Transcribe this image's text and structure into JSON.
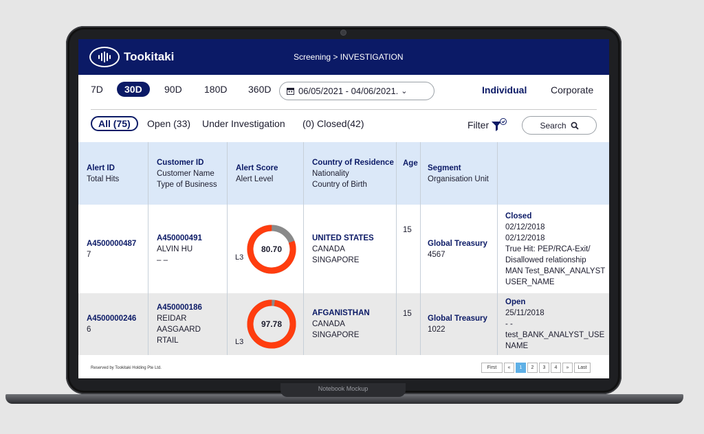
{
  "header": {
    "brand": "Tookitaki",
    "breadcrumb": "Screening > INVESTIGATION"
  },
  "periods": [
    "7D",
    "30D",
    "90D",
    "180D",
    "360D"
  ],
  "selected_period": "30D",
  "date_range": "06/05/2021 - 04/06/2021.",
  "segments": {
    "individual": "Individual",
    "corporate": "Corporate",
    "selected": "Individual"
  },
  "status_filters": {
    "all": "All (75)",
    "open": "Open (33)",
    "under_investigation": "Under Investigation",
    "closed": "(0) Closed(42)"
  },
  "filter_label": "Filter",
  "search_label": "Search",
  "table": {
    "headers": {
      "c1": {
        "main": "Alert ID",
        "sub": "Total Hits"
      },
      "c2": {
        "main": "Customer ID",
        "sub1": "Customer Name",
        "sub2": "Type of Business"
      },
      "c3": {
        "main": "Alert Score",
        "sub": "Alert Level"
      },
      "c4": {
        "main": "Country of Residence",
        "sub1": "Nationality",
        "sub2": "Country of Birth"
      },
      "c5": {
        "main": "Age"
      },
      "c6": {
        "main": "Segment",
        "sub": "Organisation Unit"
      }
    },
    "rows": [
      {
        "alert_id": "A4500000487",
        "total_hits": "7",
        "customer_id": "A450000491",
        "customer_name": "ALVIN HU",
        "business": "– –",
        "score": "80.70",
        "score_value": 80.7,
        "level": "L3",
        "residence": "UNITED STATES",
        "nationality": "CANADA",
        "birth": "SINGAPORE",
        "age": "15",
        "segment": "Global Treasury",
        "org_unit": "4567",
        "status": "Closed",
        "details": [
          "02/12/2018",
          "02/12/2018",
          "True Hit: PEP/RCA-Exit/",
          "Disallowed relationship",
          "MAN Test_BANK_ANALYST",
          "USER_NAME"
        ]
      },
      {
        "alert_id": "A4500000246",
        "total_hits": "6",
        "customer_id": "A450000186",
        "customer_name": "REIDAR AASGAARD",
        "business": "RTAIL",
        "score": "97.78",
        "score_value": 97.78,
        "level": "L3",
        "residence": "AFGANISTHAN",
        "nationality": "CANADA",
        "birth": "SINGAPORE",
        "age": "15",
        "segment": "Global Treasury",
        "org_unit": "1022",
        "status": "Open",
        "details": [
          "25/11/2018",
          "- -",
          "test_BANK_ANALYST_USE",
          "NAME"
        ]
      }
    ]
  },
  "footer": {
    "reserved": "Reserved by Tookitaki Holding Pte Ltd."
  },
  "pagination": {
    "first": "First",
    "prev": "«",
    "pages": [
      "1",
      "2",
      "3",
      "4"
    ],
    "next": "»",
    "last": "Last",
    "current": "1"
  },
  "laptop_label": "Notebook Mockup",
  "colors": {
    "navy": "#0b1a66",
    "header_row": "#dbe8f8",
    "score_ring": "#ff3d0f",
    "score_track": "#8a8a8a",
    "page_active": "#5fb0e6"
  }
}
